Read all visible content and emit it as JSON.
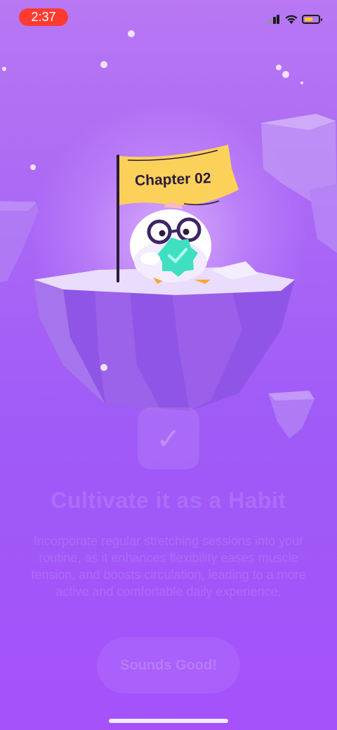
{
  "status_bar": {
    "time": "2:37"
  },
  "illustration": {
    "flag_text": "Chapter 02",
    "mascot": "owl-mascot",
    "badge_icon": "checkmark-badge-icon"
  },
  "content": {
    "icon": "stretch-icon",
    "title": "Cultivate it as a Habit",
    "description": "Incorporate regular stretching sessions into your routine, as it enhances flexibility eases muscle tension, and boosts circulation, leading to a more active and comfortable daily experience."
  },
  "cta": {
    "label": "Sounds Good!"
  },
  "colors": {
    "background_top": "#b877f3",
    "background_bottom": "#a552fb",
    "flag": "#fcd15a",
    "time_pill": "#ff3b30"
  }
}
